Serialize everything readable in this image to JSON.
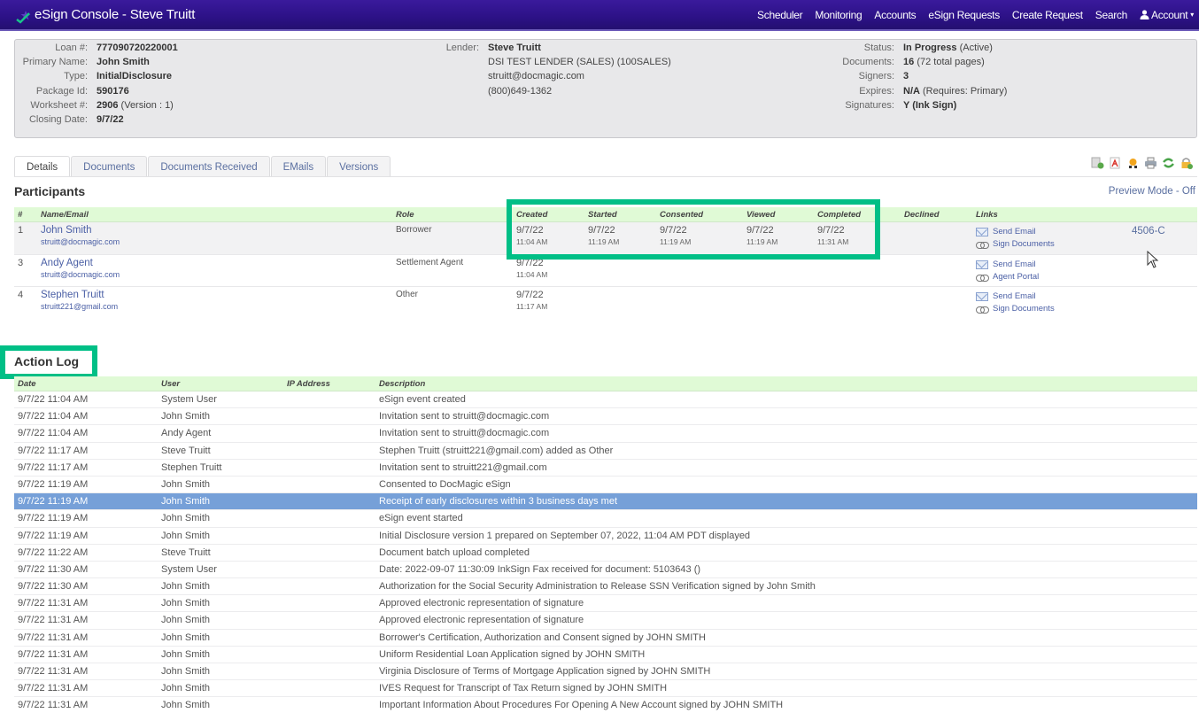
{
  "app": {
    "title": "eSign Console - Steve Truitt",
    "logo_icon": "checkmark-star-logo",
    "nav": [
      "Scheduler",
      "Monitoring",
      "Accounts",
      "eSign Requests",
      "Create Request",
      "Search"
    ],
    "account_label": "Account"
  },
  "summary": {
    "left": {
      "labels": [
        "Loan #:",
        "Primary Name:",
        "Type:",
        "Package Id:",
        "Worksheet #:",
        "Closing Date:"
      ],
      "loan_number": "777090720220001",
      "primary_name": "John Smith",
      "type": "InitialDisclosure",
      "package_id": "590176",
      "worksheet_number": "2906",
      "worksheet_version": "(Version : 1)",
      "closing_date": "9/7/22"
    },
    "lender": {
      "label": "Lender:",
      "name": "Steve Truitt",
      "company": "DSI TEST LENDER (SALES) (100SALES)",
      "email": "struitt@docmagic.com",
      "phone": "(800)649-1362"
    },
    "right": {
      "labels": [
        "Status:",
        "Documents:",
        "Signers:",
        "Expires:",
        "Signatures:"
      ],
      "status": "In Progress",
      "status_note": "(Active)",
      "documents": "16",
      "documents_note": "(72 total pages)",
      "signers": "3",
      "expires": "N/A",
      "expires_note": "(Requires: Primary)",
      "signatures": "Y (Ink Sign)"
    }
  },
  "tabs": [
    {
      "label": "Details",
      "active": true
    },
    {
      "label": "Documents",
      "active": false
    },
    {
      "label": "Documents Received",
      "active": false
    },
    {
      "label": "EMails",
      "active": false
    },
    {
      "label": "Versions",
      "active": false
    }
  ],
  "toolbar_icons": [
    "add-document-icon",
    "pdf-icon",
    "certificate-icon",
    "print-icon",
    "refresh-icon",
    "lock-icon"
  ],
  "participants": {
    "title": "Participants",
    "preview_mode": "Preview Mode - Off",
    "columns": [
      "#",
      "Name/Email",
      "Role",
      "Created",
      "Started",
      "Consented",
      "Viewed",
      "Completed",
      "Declined",
      "Links"
    ],
    "rows": [
      {
        "num": "1",
        "name": "John Smith",
        "email": "struitt@docmagic.com",
        "role": "Borrower",
        "created": [
          "9/7/22",
          "11:04 AM"
        ],
        "started": [
          "9/7/22",
          "11:19 AM"
        ],
        "consented": [
          "9/7/22",
          "11:19 AM"
        ],
        "viewed": [
          "9/7/22",
          "11:19 AM"
        ],
        "completed": [
          "9/7/22",
          "11:31 AM"
        ],
        "declined": "",
        "links": [
          "Send Email",
          "Sign Documents"
        ],
        "extra": "4506-C"
      },
      {
        "num": "3",
        "name": "Andy Agent",
        "email": "struitt@docmagic.com",
        "role": "Settlement Agent",
        "created": [
          "9/7/22",
          "11:04 AM"
        ],
        "links": [
          "Send Email",
          "Agent Portal"
        ]
      },
      {
        "num": "4",
        "name": "Stephen Truitt",
        "email": "struitt221@gmail.com",
        "role": "Other",
        "created": [
          "9/7/22",
          "11:17 AM"
        ],
        "links": [
          "Send Email",
          "Sign Documents"
        ]
      }
    ]
  },
  "action_log": {
    "title": "Action Log",
    "columns": [
      "Date",
      "User",
      "IP Address",
      "Description"
    ],
    "selected_index": 6,
    "highlight_color": "#76a0d8",
    "rows": [
      {
        "date": "9/7/22 11:04 AM",
        "user": "System User",
        "ip": "",
        "desc": "eSign event created"
      },
      {
        "date": "9/7/22 11:04 AM",
        "user": "John Smith",
        "ip": "",
        "desc": "Invitation sent to struitt@docmagic.com"
      },
      {
        "date": "9/7/22 11:04 AM",
        "user": "Andy Agent",
        "ip": "",
        "desc": "Invitation sent to struitt@docmagic.com"
      },
      {
        "date": "9/7/22 11:17 AM",
        "user": "Steve Truitt",
        "ip": "",
        "desc": "Stephen Truitt (struitt221@gmail.com) added as Other"
      },
      {
        "date": "9/7/22 11:17 AM",
        "user": "Stephen Truitt",
        "ip": "",
        "desc": "Invitation sent to struitt221@gmail.com"
      },
      {
        "date": "9/7/22 11:19 AM",
        "user": "John Smith",
        "ip": "",
        "desc": "Consented to DocMagic eSign"
      },
      {
        "date": "9/7/22 11:19 AM",
        "user": "John Smith",
        "ip": "",
        "desc": "Receipt of early disclosures within 3 business days met"
      },
      {
        "date": "9/7/22 11:19 AM",
        "user": "John Smith",
        "ip": "",
        "desc": "eSign event started"
      },
      {
        "date": "9/7/22 11:19 AM",
        "user": "John Smith",
        "ip": "",
        "desc": "Initial Disclosure version 1 prepared on September 07, 2022, 11:04 AM PDT displayed"
      },
      {
        "date": "9/7/22 11:22 AM",
        "user": "Steve Truitt",
        "ip": "",
        "desc": "Document batch upload completed"
      },
      {
        "date": "9/7/22 11:30 AM",
        "user": "System User",
        "ip": "",
        "desc": "Date: 2022-09-07 11:30:09 InkSign Fax received for document: 5103643 ()"
      },
      {
        "date": "9/7/22 11:30 AM",
        "user": "John Smith",
        "ip": "",
        "desc": "Authorization for the Social Security Administration to Release SSN Verification signed by John Smith"
      },
      {
        "date": "9/7/22 11:31 AM",
        "user": "John Smith",
        "ip": "",
        "desc": "Approved electronic representation of signature"
      },
      {
        "date": "9/7/22 11:31 AM",
        "user": "John Smith",
        "ip": "",
        "desc": "Approved electronic representation of signature"
      },
      {
        "date": "9/7/22 11:31 AM",
        "user": "John Smith",
        "ip": "",
        "desc": "Borrower's Certification, Authorization and Consent signed by JOHN SMITH"
      },
      {
        "date": "9/7/22 11:31 AM",
        "user": "John Smith",
        "ip": "",
        "desc": "Uniform Residential Loan Application signed by JOHN SMITH"
      },
      {
        "date": "9/7/22 11:31 AM",
        "user": "John Smith",
        "ip": "",
        "desc": "Virginia Disclosure of Terms of Mortgage Application signed by JOHN SMITH"
      },
      {
        "date": "9/7/22 11:31 AM",
        "user": "John Smith",
        "ip": "",
        "desc": "IVES Request for Transcript of Tax Return signed by JOHN SMITH"
      },
      {
        "date": "9/7/22 11:31 AM",
        "user": "John Smith",
        "ip": "",
        "desc": "Important Information About Procedures For Opening A New Account signed by JOHN SMITH"
      }
    ]
  },
  "annotation_color": "#00bf86"
}
